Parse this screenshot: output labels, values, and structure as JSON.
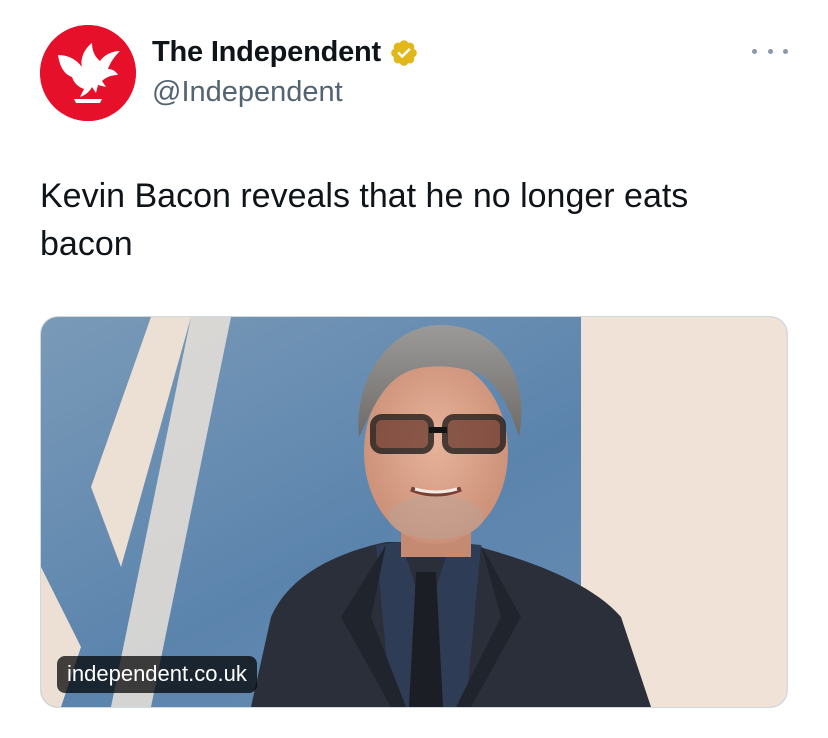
{
  "account": {
    "display_name": "The Independent",
    "handle": "@Independent",
    "avatar_icon": "eagle-logo",
    "avatar_color": "#e6102a",
    "verified_badge": "gold-check",
    "verified_color": "#e2b719"
  },
  "menu": {
    "more_icon": "more-horizontal-icon"
  },
  "tweet": {
    "text": "Kevin Bacon reveals that he no longer eats bacon"
  },
  "media": {
    "domain": "independent.co.uk",
    "photo_description": "photo-portrait"
  },
  "colors": {
    "text_primary": "#0f1419",
    "text_secondary": "#536471",
    "card_border": "#cfd9de"
  }
}
